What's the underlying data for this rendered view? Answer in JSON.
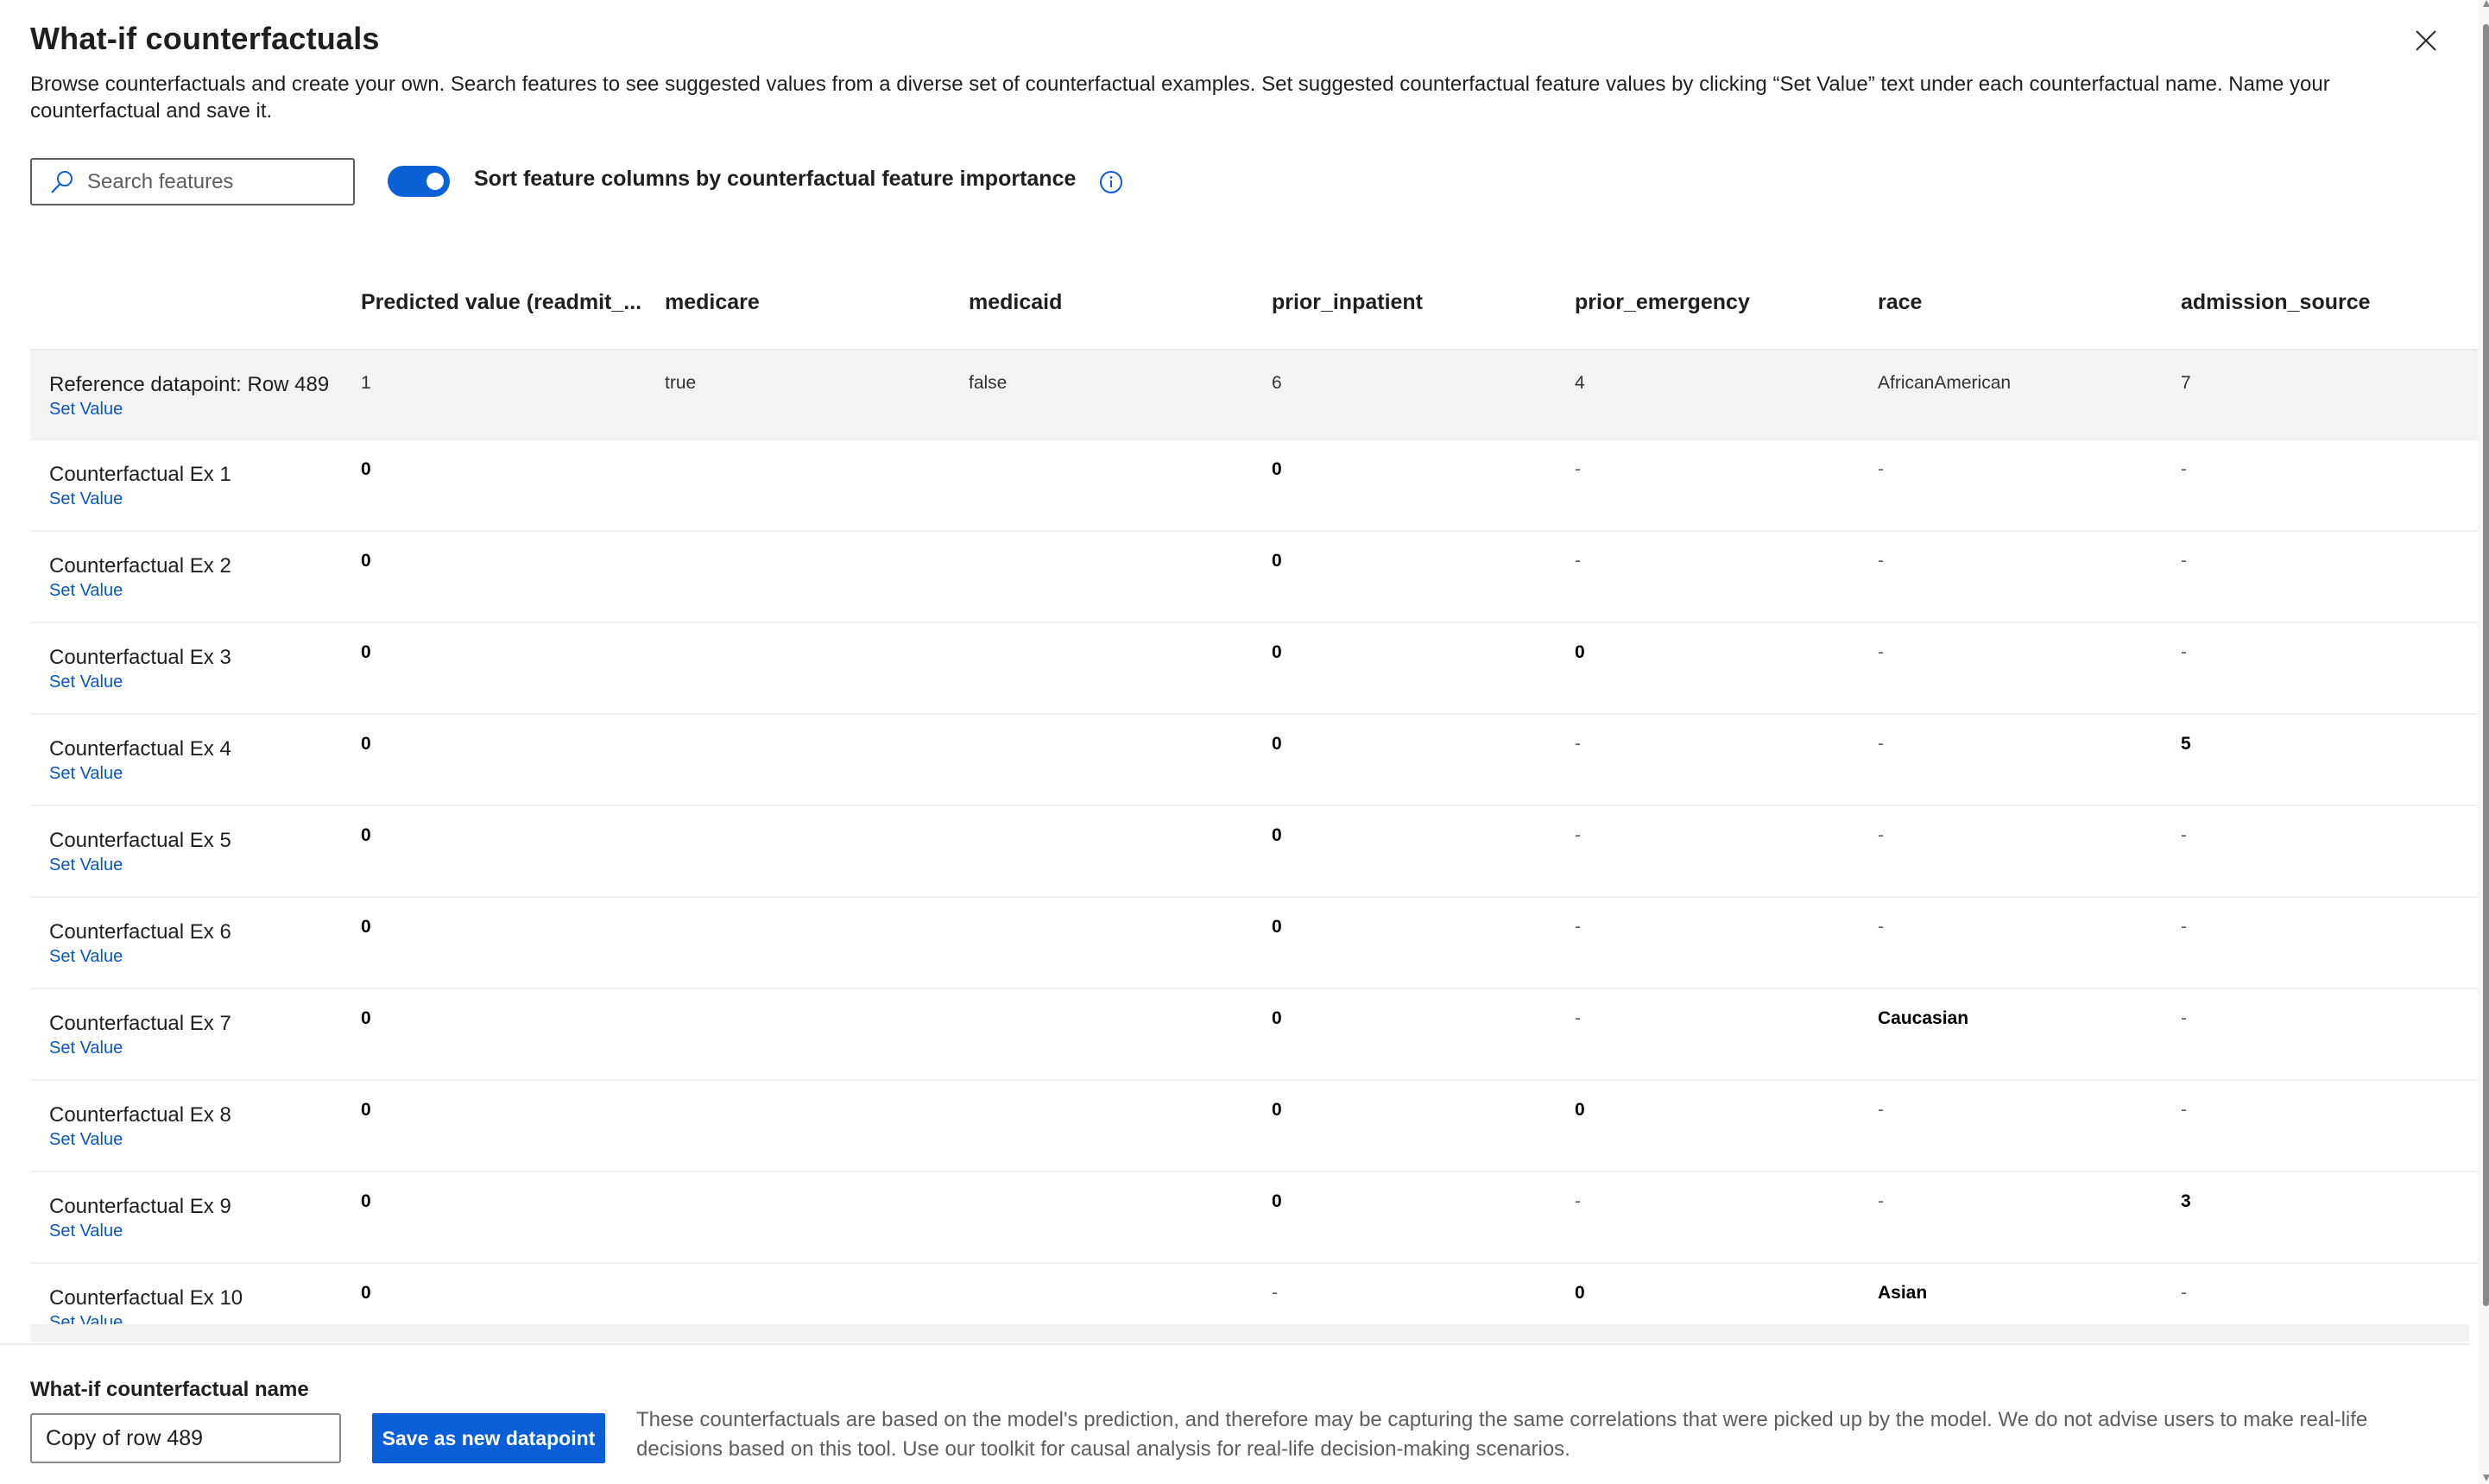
{
  "panel": {
    "title": "What-if counterfactuals",
    "description": "Browse counterfactuals and create your own. Search features to see suggested values from a diverse set of counterfactual examples. Set suggested counterfactual feature values by clicking “Set Value” text under each counterfactual name. Name your counterfactual and save it.",
    "close_icon": "close-icon"
  },
  "toolbar": {
    "search_placeholder": "Search features",
    "search_value": "",
    "search_icon": "search-icon",
    "toggle_on": true,
    "toggle_label": "Sort feature columns by counterfactual feature importance",
    "info_icon": "info-icon"
  },
  "colors": {
    "accent": "#0b5fd6",
    "link": "#0b57c2",
    "reference_row_bg": "#f3f3f3"
  },
  "table": {
    "columns": [
      "Predicted value (readmit_...",
      "medicare",
      "medicaid",
      "prior_inpatient",
      "prior_emergency",
      "race",
      "admission_source"
    ],
    "set_value_label": "Set Value",
    "rows": [
      {
        "name": "Reference datapoint: Row 489",
        "reference": true,
        "cells": [
          {
            "v": "1"
          },
          {
            "v": "true"
          },
          {
            "v": "false"
          },
          {
            "v": "6"
          },
          {
            "v": "4"
          },
          {
            "v": "AfricanAmerican"
          },
          {
            "v": "7"
          }
        ]
      },
      {
        "name": "Counterfactual Ex 1",
        "cells": [
          {
            "v": "0",
            "c": true
          },
          {
            "v": ""
          },
          {
            "v": ""
          },
          {
            "v": "0",
            "c": true
          },
          {
            "v": "-"
          },
          {
            "v": "-"
          },
          {
            "v": "-"
          }
        ]
      },
      {
        "name": "Counterfactual Ex 2",
        "cells": [
          {
            "v": "0",
            "c": true
          },
          {
            "v": ""
          },
          {
            "v": ""
          },
          {
            "v": "0",
            "c": true
          },
          {
            "v": "-"
          },
          {
            "v": "-"
          },
          {
            "v": "-"
          }
        ]
      },
      {
        "name": "Counterfactual Ex 3",
        "cells": [
          {
            "v": "0",
            "c": true
          },
          {
            "v": ""
          },
          {
            "v": ""
          },
          {
            "v": "0",
            "c": true
          },
          {
            "v": "0",
            "c": true
          },
          {
            "v": "-"
          },
          {
            "v": "-"
          }
        ]
      },
      {
        "name": "Counterfactual Ex 4",
        "cells": [
          {
            "v": "0",
            "c": true
          },
          {
            "v": ""
          },
          {
            "v": ""
          },
          {
            "v": "0",
            "c": true
          },
          {
            "v": "-"
          },
          {
            "v": "-"
          },
          {
            "v": "5",
            "c": true
          }
        ]
      },
      {
        "name": "Counterfactual Ex 5",
        "cells": [
          {
            "v": "0",
            "c": true
          },
          {
            "v": ""
          },
          {
            "v": ""
          },
          {
            "v": "0",
            "c": true
          },
          {
            "v": "-"
          },
          {
            "v": "-"
          },
          {
            "v": "-"
          }
        ]
      },
      {
        "name": "Counterfactual Ex 6",
        "cells": [
          {
            "v": "0",
            "c": true
          },
          {
            "v": ""
          },
          {
            "v": ""
          },
          {
            "v": "0",
            "c": true
          },
          {
            "v": "-"
          },
          {
            "v": "-"
          },
          {
            "v": "-"
          }
        ]
      },
      {
        "name": "Counterfactual Ex 7",
        "cells": [
          {
            "v": "0",
            "c": true
          },
          {
            "v": ""
          },
          {
            "v": ""
          },
          {
            "v": "0",
            "c": true
          },
          {
            "v": "-"
          },
          {
            "v": "Caucasian",
            "c": true
          },
          {
            "v": "-"
          }
        ]
      },
      {
        "name": "Counterfactual Ex 8",
        "cells": [
          {
            "v": "0",
            "c": true
          },
          {
            "v": ""
          },
          {
            "v": ""
          },
          {
            "v": "0",
            "c": true
          },
          {
            "v": "0",
            "c": true
          },
          {
            "v": "-"
          },
          {
            "v": "-"
          }
        ]
      },
      {
        "name": "Counterfactual Ex 9",
        "cells": [
          {
            "v": "0",
            "c": true
          },
          {
            "v": ""
          },
          {
            "v": ""
          },
          {
            "v": "0",
            "c": true
          },
          {
            "v": "-"
          },
          {
            "v": "-"
          },
          {
            "v": "3",
            "c": true
          }
        ]
      },
      {
        "name": "Counterfactual Ex 10",
        "cells": [
          {
            "v": "0",
            "c": true
          },
          {
            "v": ""
          },
          {
            "v": ""
          },
          {
            "v": "-"
          },
          {
            "v": "0",
            "c": true
          },
          {
            "v": "Asian",
            "c": true
          },
          {
            "v": "-"
          }
        ]
      }
    ]
  },
  "footer": {
    "name_label": "What-if counterfactual name",
    "name_value": "Copy of row 489",
    "save_button_label": "Save as new datapoint",
    "disclaimer": "These counterfactuals are based on the model's prediction, and therefore may be capturing the same correlations that were picked up by the model. We do not advise users to make real-life decisions based on this tool. Use our toolkit for causal analysis for real-life decision-making scenarios."
  }
}
